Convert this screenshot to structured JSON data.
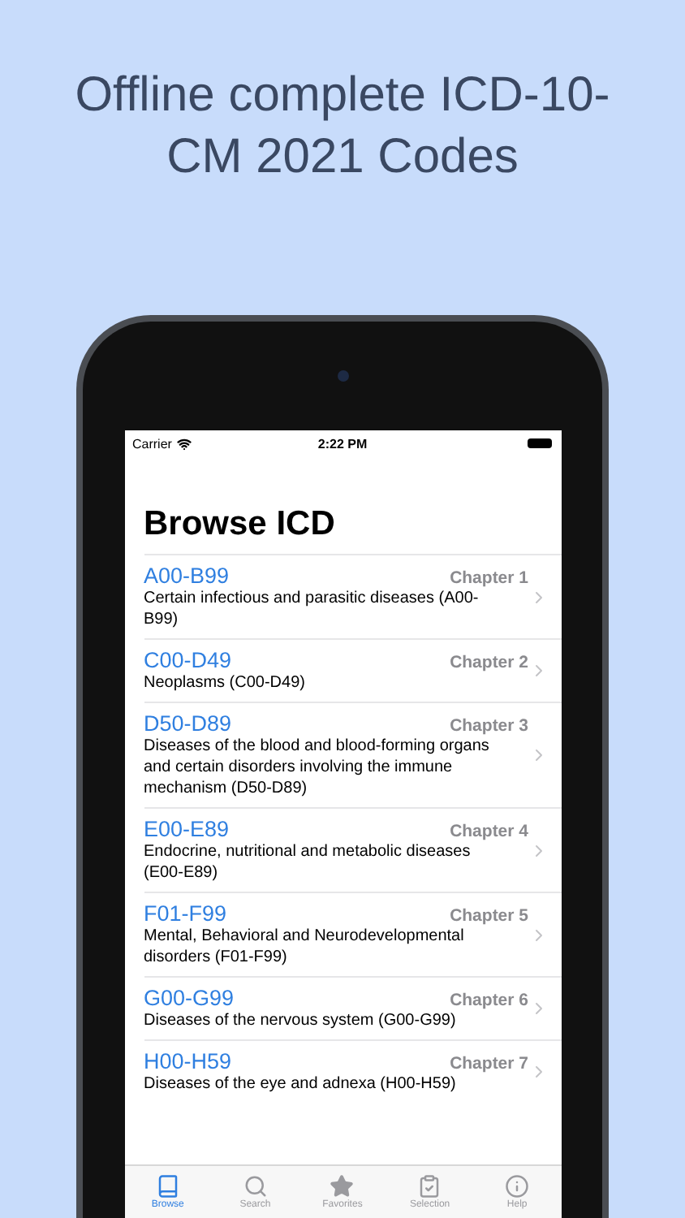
{
  "headline": "Offline complete ICD-10-CM 2021 Codes",
  "status_bar": {
    "carrier": "Carrier",
    "time": "2:22 PM"
  },
  "screen_title": "Browse ICD",
  "chapters": [
    {
      "code": "A00-B99",
      "chapter": "Chapter 1",
      "description": "Certain infectious and parasitic diseases (A00-B99)"
    },
    {
      "code": "C00-D49",
      "chapter": "Chapter 2",
      "description": "Neoplasms (C00-D49)"
    },
    {
      "code": "D50-D89",
      "chapter": "Chapter 3",
      "description": "Diseases of the blood and blood-forming organs and certain disorders involving the immune mechanism (D50-D89)"
    },
    {
      "code": "E00-E89",
      "chapter": "Chapter 4",
      "description": "Endocrine, nutritional and metabolic diseases (E00-E89)"
    },
    {
      "code": "F01-F99",
      "chapter": "Chapter 5",
      "description": "Mental, Behavioral and Neurodevelopmental disorders (F01-F99)"
    },
    {
      "code": "G00-G99",
      "chapter": "Chapter 6",
      "description": "Diseases of the nervous system (G00-G99)"
    },
    {
      "code": "H00-H59",
      "chapter": "Chapter 7",
      "description": "Diseases of the eye and adnexa (H00-H59)"
    }
  ],
  "tabs": [
    {
      "kind": "browse",
      "label": "Browse",
      "selected": true
    },
    {
      "kind": "search",
      "label": "Search",
      "selected": false
    },
    {
      "kind": "favorites",
      "label": "Favorites",
      "selected": false
    },
    {
      "kind": "selection",
      "label": "Selection",
      "selected": false
    },
    {
      "kind": "help",
      "label": "Help",
      "selected": false
    }
  ]
}
